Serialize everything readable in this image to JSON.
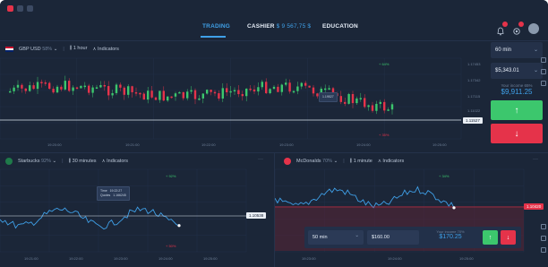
{
  "nav": {
    "trading": "TRADING",
    "cashier": "CASHIER",
    "cashier_value": "$ 9 567,75 $",
    "education": "EDUCATION"
  },
  "main_chart": {
    "symbol": "GBP USD",
    "percent": "58%",
    "timeframe": "1 hour",
    "indicators": "Indicators",
    "tooltip_value": "1.19527",
    "price_tag": "1.11527",
    "marker_up": "+ 64%",
    "marker_down": "+ 35%",
    "y_ticks": [
      "1.17453",
      "1.17342",
      "1.17115",
      "1.11022"
    ],
    "x_ticks": [
      "19:20:00",
      "19:21:00",
      "19:22:00",
      "19:23:00",
      "19:24:00",
      "19:25:00"
    ],
    "colors": {
      "up": "#3cc76d",
      "down": "#e5334a"
    }
  },
  "sidebar": {
    "duration": "60 min",
    "amount": "$5,343.01",
    "income_label": "Your income 65%",
    "income_value": "$9,911.25",
    "up_icon": "arrow-up-icon",
    "down_icon": "arrow-down-icon"
  },
  "chart_starbucks": {
    "symbol": "Starbucks",
    "percent": "92%",
    "timeframe": "30 minutes",
    "indicators": "Indicators",
    "marker_up": "+ 92%",
    "marker_down": "+ 50%",
    "tooltip_time_label": "Time",
    "tooltip_time": "19:22:27",
    "tooltip_quotes_label": "Quotes",
    "tooltip_quotes": "1.166245",
    "price_tag": "1.10538",
    "x_ticks": [
      "19:21:00",
      "19:22:00",
      "19:23:00",
      "19:24:00",
      "19:25:00"
    ]
  },
  "chart_mcdonalds": {
    "symbol": "McDonalds",
    "percent": "70%",
    "timeframe": "1 minute",
    "indicators": "Indicators",
    "marker_up": "+ 34%",
    "price_tag": "1.10420",
    "duration": "50 min",
    "amount": "$160.00",
    "income_label": "Your income 70%",
    "income_value": "$170.25",
    "x_ticks": [
      "19:23:00",
      "19:24:00",
      "19:25:00"
    ]
  }
}
